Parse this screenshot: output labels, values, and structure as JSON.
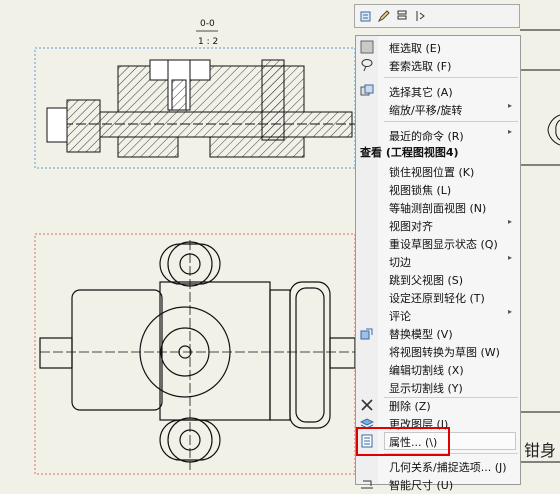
{
  "drawing": {
    "scale_top": "0-0",
    "scale_bottom": "1 : 2",
    "title_block_text": "钳身"
  },
  "menu": {
    "items": [
      {
        "label": "框选取 (E)",
        "icon": "box-select-icon",
        "arrow": ""
      },
      {
        "label": "套索选取 (F)",
        "icon": "lasso-icon",
        "arrow": ""
      },
      {
        "label": "选择其它 (A)",
        "icon": "select-other-icon",
        "arrow": ""
      },
      {
        "label": "缩放/平移/旋转",
        "icon": "",
        "arrow": "▸"
      },
      {
        "label": "最近的命令 (R)",
        "icon": "",
        "arrow": "▸"
      },
      {
        "label": "锁住视图位置 (K)",
        "icon": "",
        "arrow": ""
      },
      {
        "label": "视图锁焦 (L)",
        "icon": "",
        "arrow": ""
      },
      {
        "label": "等轴测剖面视图 (N)",
        "icon": "",
        "arrow": ""
      },
      {
        "label": "视图对齐",
        "icon": "",
        "arrow": "▸"
      },
      {
        "label": "重设草图显示状态 (Q)",
        "icon": "",
        "arrow": ""
      },
      {
        "label": "切边",
        "icon": "",
        "arrow": "▸"
      },
      {
        "label": "跳到父视图 (S)",
        "icon": "",
        "arrow": ""
      },
      {
        "label": "设定还原到轻化 (T)",
        "icon": "",
        "arrow": ""
      },
      {
        "label": "评论",
        "icon": "",
        "arrow": "▸"
      },
      {
        "label": "替换模型 (V)",
        "icon": "replace-model-icon",
        "arrow": ""
      },
      {
        "label": "将视图转换为草图 (W)",
        "icon": "",
        "arrow": ""
      },
      {
        "label": "编辑切割线 (X)",
        "icon": "",
        "arrow": ""
      },
      {
        "label": "显示切割线 (Y)",
        "icon": "",
        "arrow": ""
      },
      {
        "label": "删除 (Z)",
        "icon": "delete-x-icon",
        "arrow": ""
      },
      {
        "label": "更改图层 (I)",
        "icon": "layers-icon",
        "arrow": ""
      },
      {
        "label": "属性... (\\)",
        "icon": "properties-icon",
        "arrow": ""
      },
      {
        "label": "几何关系/捕捉选项... (J)",
        "icon": "",
        "arrow": ""
      },
      {
        "label": "智能尺寸 (U)",
        "icon": "smart-dimension-icon",
        "arrow": ""
      }
    ],
    "section_header": "查看 (工程图视图4)"
  },
  "colors": {
    "highlight_red": "#e00000",
    "view_border_blue": "#5aa0d8",
    "view_border_red": "#d87070"
  }
}
